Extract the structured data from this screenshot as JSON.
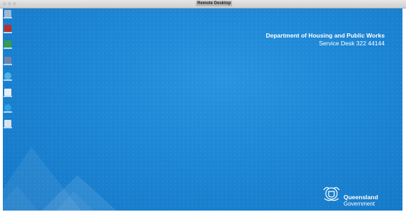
{
  "window": {
    "title": "Remote Desktop",
    "traffic_lights": [
      "close",
      "minimize",
      "maximize"
    ]
  },
  "desktop": {
    "background_color": "#1d86d5",
    "department": "Department of Housing and Public Works",
    "service_desk": "Service Desk 322 44144",
    "branding": {
      "line1": "Queensland",
      "line2": "Government"
    },
    "icons": [
      {
        "name": "recycle-bin-icon",
        "color": "#9db9d6"
      },
      {
        "name": "pdf-icon",
        "color": "#b8312b"
      },
      {
        "name": "spreadsheet-icon",
        "color": "#3a9b4a"
      },
      {
        "name": "folder-icon",
        "color": "#6f86a8"
      },
      {
        "name": "internet-explorer-icon",
        "color": "#4fb3e8"
      },
      {
        "name": "network-icon",
        "color": "#e7eef5"
      },
      {
        "name": "skype-icon",
        "color": "#2aa2e6"
      },
      {
        "name": "shortcut-icon",
        "color": "#d7e3ef"
      }
    ]
  }
}
